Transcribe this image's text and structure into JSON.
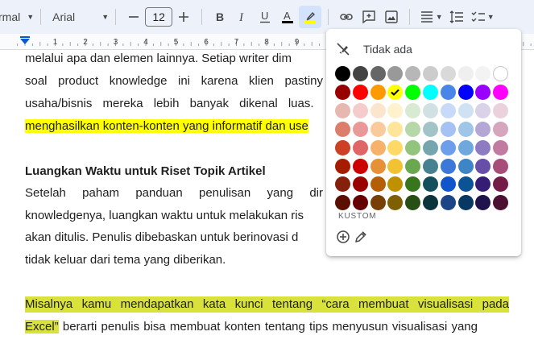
{
  "toolbar": {
    "style_label": "rmal",
    "font_label": "Arial",
    "font_size": "12",
    "icons": [
      "chevron-down-icon",
      "minus-icon",
      "plus-icon",
      "bold-icon",
      "italic-icon",
      "underline-icon",
      "text-color-icon",
      "highlighter-icon",
      "link-icon",
      "add-comment-icon",
      "image-icon",
      "align-icon",
      "line-spacing-icon",
      "checklist-icon"
    ],
    "accent": "#0b57d0",
    "text_color_bar": "#000000",
    "highlight_bar": "#ffff00"
  },
  "ruler": {
    "labels": [
      "1",
      "2",
      "3",
      "4",
      "5",
      "6",
      "7",
      "8",
      "9"
    ]
  },
  "document": {
    "lines": [
      "melalui apa dan elemen lainnya. Setiap writer dim",
      "soal product knowledge ini karena klien pastiny",
      "usaha/bisnis mereka lebih banyak dikenal luas.",
      "menghasilkan konten-konten yang informatif dan use",
      "Luangkan Waktu untuk Riset Topik Artikel",
      "Setelah paham panduan penulisan yang dir",
      "knowledgenya, luangkan waktu untuk melakukan ris",
      "akan ditulis. Penulis dibebaskan untuk berinovasi d",
      "tidak keluar dari tema yang diberikan.",
      "Misalnya kamu mendapatkan kata kunci tentang “cara membuat visualisasi pada",
      "Excel”",
      " berarti penulis bisa membuat konten tentang tips menyusun visualisasi yang"
    ]
  },
  "highlight_popup": {
    "none_label": "Tidak ada",
    "custom_label": "KUSTOM",
    "selected_color": "#ffff00",
    "rows": [
      [
        "#000000",
        "#434343",
        "#666666",
        "#999999",
        "#b7b7b7",
        "#cccccc",
        "#d9d9d9",
        "#efefef",
        "#f3f3f3",
        "#ffffff"
      ],
      [
        "#980000",
        "#ff0000",
        "#ff9900",
        "#ffff00",
        "#00ff00",
        "#00ffff",
        "#4a86e8",
        "#0000ff",
        "#9900ff",
        "#ff00ff"
      ],
      [
        "#e6b8af",
        "#f4cccc",
        "#fce5cd",
        "#fff2cc",
        "#d9ead3",
        "#d0e0e3",
        "#c9daf8",
        "#cfe2f3",
        "#d9d2e9",
        "#ead1dc"
      ],
      [
        "#dd7e6b",
        "#ea9999",
        "#f9cb9c",
        "#ffe599",
        "#b6d7a8",
        "#a2c4c9",
        "#a4c2f4",
        "#9fc5e8",
        "#b4a7d6",
        "#d5a6bd"
      ],
      [
        "#cc4125",
        "#e06666",
        "#f6b26b",
        "#ffd966",
        "#93c47d",
        "#76a5af",
        "#6d9eeb",
        "#6fa8dc",
        "#8e7cc3",
        "#c27ba0"
      ],
      [
        "#a61c00",
        "#cc0000",
        "#e69138",
        "#f1c232",
        "#6aa84f",
        "#45818e",
        "#3c78d8",
        "#3d85c6",
        "#674ea7",
        "#a64d79"
      ],
      [
        "#85200c",
        "#990000",
        "#b45f06",
        "#bf9000",
        "#38761d",
        "#134f5c",
        "#1155cc",
        "#0b5394",
        "#351c75",
        "#741b47"
      ],
      [
        "#5b0f00",
        "#660000",
        "#783f04",
        "#7f6000",
        "#274e13",
        "#0c343d",
        "#1c4587",
        "#073763",
        "#20124d",
        "#4c1130"
      ]
    ]
  }
}
